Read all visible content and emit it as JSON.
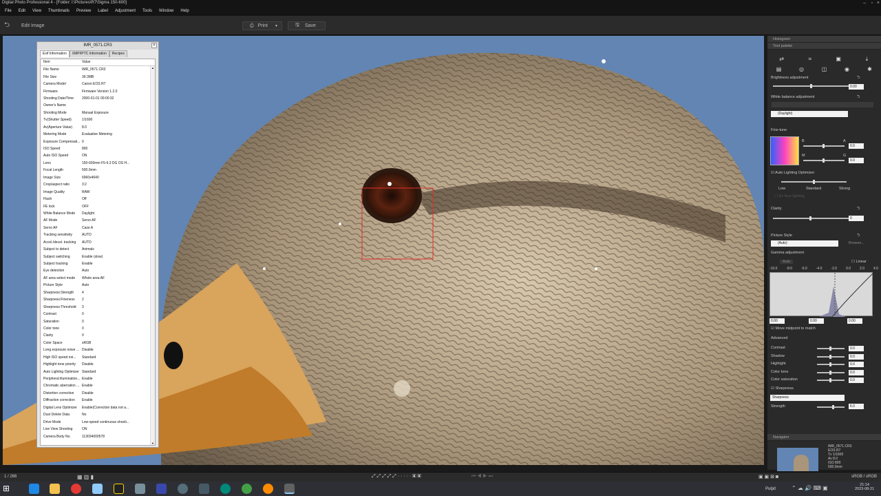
{
  "window": {
    "title": "Digital Photo Professional 4 - [Folder: I:\\Pictures\\R7\\Sigma 150-600]"
  },
  "menu": [
    "File",
    "Edit",
    "View",
    "Thumbnails",
    "Preview",
    "Label",
    "Adjustment",
    "Tools",
    "Window",
    "Help"
  ],
  "toolbar": {
    "edit_label": "Edit Image",
    "print_label": "Print",
    "save_label": "Save"
  },
  "exif": {
    "filename": "IMR_0571.CR3",
    "tabs": [
      "Exif Information",
      "XMP/IPTC Information",
      "Recipes"
    ],
    "headers": [
      "Item",
      "Value"
    ],
    "rows": [
      [
        "File Name",
        "IMR_0571.CR3"
      ],
      [
        "File Size",
        "39.3MB"
      ],
      [
        "Camera Model",
        "Canon EOS R7"
      ],
      [
        "Firmware",
        "Firmware Version 1.2.0"
      ],
      [
        "Shooting Date/Time",
        "2000-01-01 00:00:32"
      ],
      [
        "Owner's Name",
        ""
      ],
      [
        "Shooting Mode",
        "Manual Exposure"
      ],
      [
        "Tv(Shutter Speed)",
        "1/1600"
      ],
      [
        "Av(Aperture Value)",
        "8.0"
      ],
      [
        "Metering Mode",
        "Evaluative Metering"
      ],
      [
        "Exposure Compensati...",
        "0"
      ],
      [
        "ISO Speed",
        "800"
      ],
      [
        "Auto ISO Speed",
        "ON"
      ],
      [
        "Lens",
        "150-600mm F5-6.3 DG OS H..."
      ],
      [
        "Focal Length",
        "500.0mm"
      ],
      [
        "Image Size",
        "6960x4640"
      ],
      [
        "Crop/aspect ratio",
        "3:2"
      ],
      [
        "Image Quality",
        "RAW"
      ],
      [
        "Flash",
        "Off"
      ],
      [
        "FE lock",
        "OFF"
      ],
      [
        "White Balance Mode",
        "Daylight"
      ],
      [
        "AF Mode",
        "Servo AF"
      ],
      [
        "Servo AF",
        "Case A"
      ],
      [
        "Tracking sensitivity",
        "AUTO"
      ],
      [
        "Accel./decel. tracking",
        "AUTO"
      ],
      [
        "Subject to detect",
        "Animals"
      ],
      [
        "Subject switching",
        "Enable (slow)"
      ],
      [
        "Subject tracking",
        "Enable"
      ],
      [
        "Eye detection",
        "Auto"
      ],
      [
        "AF area select mode",
        "Whole area AF"
      ],
      [
        "Picture Style",
        "Auto"
      ],
      [
        "Sharpness:Strength",
        "4"
      ],
      [
        "Sharpness:Fineness",
        "2"
      ],
      [
        "Sharpness:Threshold",
        "3"
      ],
      [
        "Contrast",
        "0"
      ],
      [
        "Saturation",
        "0"
      ],
      [
        "Color tone",
        "0"
      ],
      [
        "Clarity",
        "0"
      ],
      [
        "Color Space",
        "sRGB"
      ],
      [
        "Long exposure noise ...",
        "Disable"
      ],
      [
        "High ISO speed noi...",
        "Standard"
      ],
      [
        "Highlight tone priority",
        "Disable"
      ],
      [
        "Auto Lighting Optimizer",
        "Standard"
      ],
      [
        "Peripheral illumination...",
        "Enable"
      ],
      [
        "Chromatic aberration ...",
        "Enable"
      ],
      [
        "Distortion correction",
        "Disable"
      ],
      [
        "Diffraction correction",
        "Enable"
      ],
      [
        "Digital Lens Optimizer",
        "Enable(Correction data not a..."
      ],
      [
        "Dust Delete Data",
        "No"
      ],
      [
        "Drive Mode",
        "Low-speed continuous shooti..."
      ],
      [
        "Live View Shooting",
        "ON"
      ],
      [
        "Camera Body No.",
        "113034000578"
      ]
    ]
  },
  "panel": {
    "histogram": "Histogram",
    "tool_palette": "Tool palette",
    "brightness": {
      "label": "Brightness adjustment",
      "value": "0.00",
      "level": 0.5
    },
    "white_balance": {
      "label": "White balance adjustment",
      "value": "(Daylight)"
    },
    "fine_tune": {
      "label": "Fine-tune",
      "b": "B",
      "a": "A",
      "m": "M",
      "g": "G",
      "v1": "0.0",
      "v2": "0.0"
    },
    "alo": {
      "label": "Auto Lighting Optimizer",
      "low": "Low",
      "standard": "Standard",
      "strong": "Strong",
      "faces": "Ex face lighting"
    },
    "clarity": {
      "label": "Clarity",
      "value": "0"
    },
    "picture_style": {
      "label": "Picture Style",
      "value": "(Auto)",
      "browse": "Browse..."
    },
    "gamma": {
      "label": "Gamma adjustment",
      "auto": "Auto",
      "linear": "Linear",
      "ticks": [
        "-10.0",
        "-8.0",
        "-6.0",
        "-4.0",
        "-2.0",
        "0.0",
        "2.0",
        "4.0"
      ],
      "v1": "0.00",
      "v2": "0.00",
      "v3": "0.00",
      "midpoint": "Move midpoint to match"
    },
    "advanced": {
      "label": "Advanced",
      "items": [
        {
          "label": "Contrast",
          "value": "0.0"
        },
        {
          "label": "Shadow",
          "value": "0.0"
        },
        {
          "label": "Highlight",
          "value": "0.0"
        },
        {
          "label": "Color tone",
          "value": "0.0"
        },
        {
          "label": "Color saturation",
          "value": "0.0"
        }
      ]
    },
    "sharpness": {
      "label": "Sharpness",
      "mode": "Sharpness",
      "strength_label": "Strength",
      "strength": "6.0"
    },
    "navigator": {
      "label": "Navigator",
      "info": [
        "IMR_0571.CR3",
        "EOS R7",
        "Tv 1/1600",
        "Av 8.0",
        "ISO 800",
        "500.0mm"
      ]
    }
  },
  "status": {
    "counter": "1 / 266",
    "colorspace": "sRGB / sRGB"
  },
  "taskbar": {
    "tray_label": "Pulpit",
    "time": "21:14",
    "date": "2023-08-21"
  }
}
